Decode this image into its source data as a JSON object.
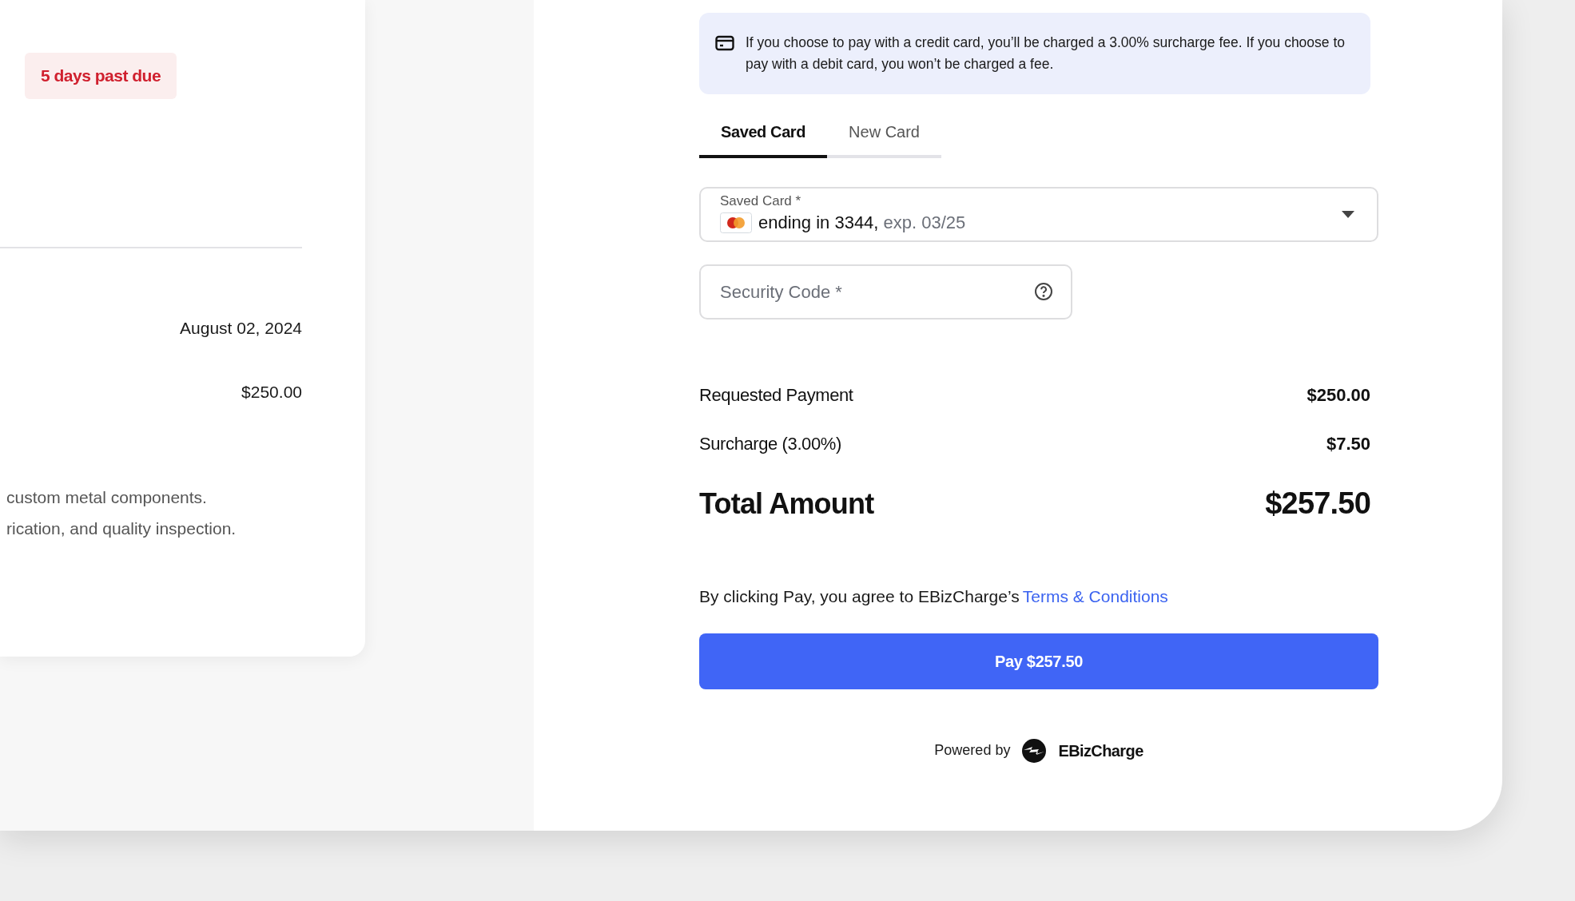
{
  "invoice_card": {
    "status_badge": "5 days past due",
    "date": "August 02, 2024",
    "amount": "$250.00",
    "description_lines": [
      "custom metal components.",
      "rication, and quality inspection."
    ]
  },
  "payment": {
    "notice": "If you choose to pay with a credit card, you’ll be charged a 3.00% surcharge fee. If you choose to pay with a debit card, you won’t be charged a fee.",
    "tabs": [
      {
        "label": "Saved Card",
        "selected": true
      },
      {
        "label": "New Card",
        "selected": false
      }
    ],
    "saved_card": {
      "label": "Saved Card *",
      "value": "ending in 3344,",
      "expiry": "exp. 03/25"
    },
    "security_code": {
      "placeholder": "Security Code *"
    },
    "summary": [
      {
        "kind": "line",
        "label": "Requested Payment",
        "value": "$250.00"
      },
      {
        "kind": "line",
        "label": "Surcharge (3.00%)",
        "value": "$7.50"
      },
      {
        "kind": "total",
        "label": "Total Amount",
        "value": "$257.50"
      }
    ],
    "terms": {
      "text": "By clicking Pay, you agree to EBizCharge’s",
      "link": "Terms & Conditions"
    },
    "pay_button": "Pay $257.50",
    "footer": {
      "powered_by": "Powered by",
      "brand": "EBizCharge"
    }
  }
}
